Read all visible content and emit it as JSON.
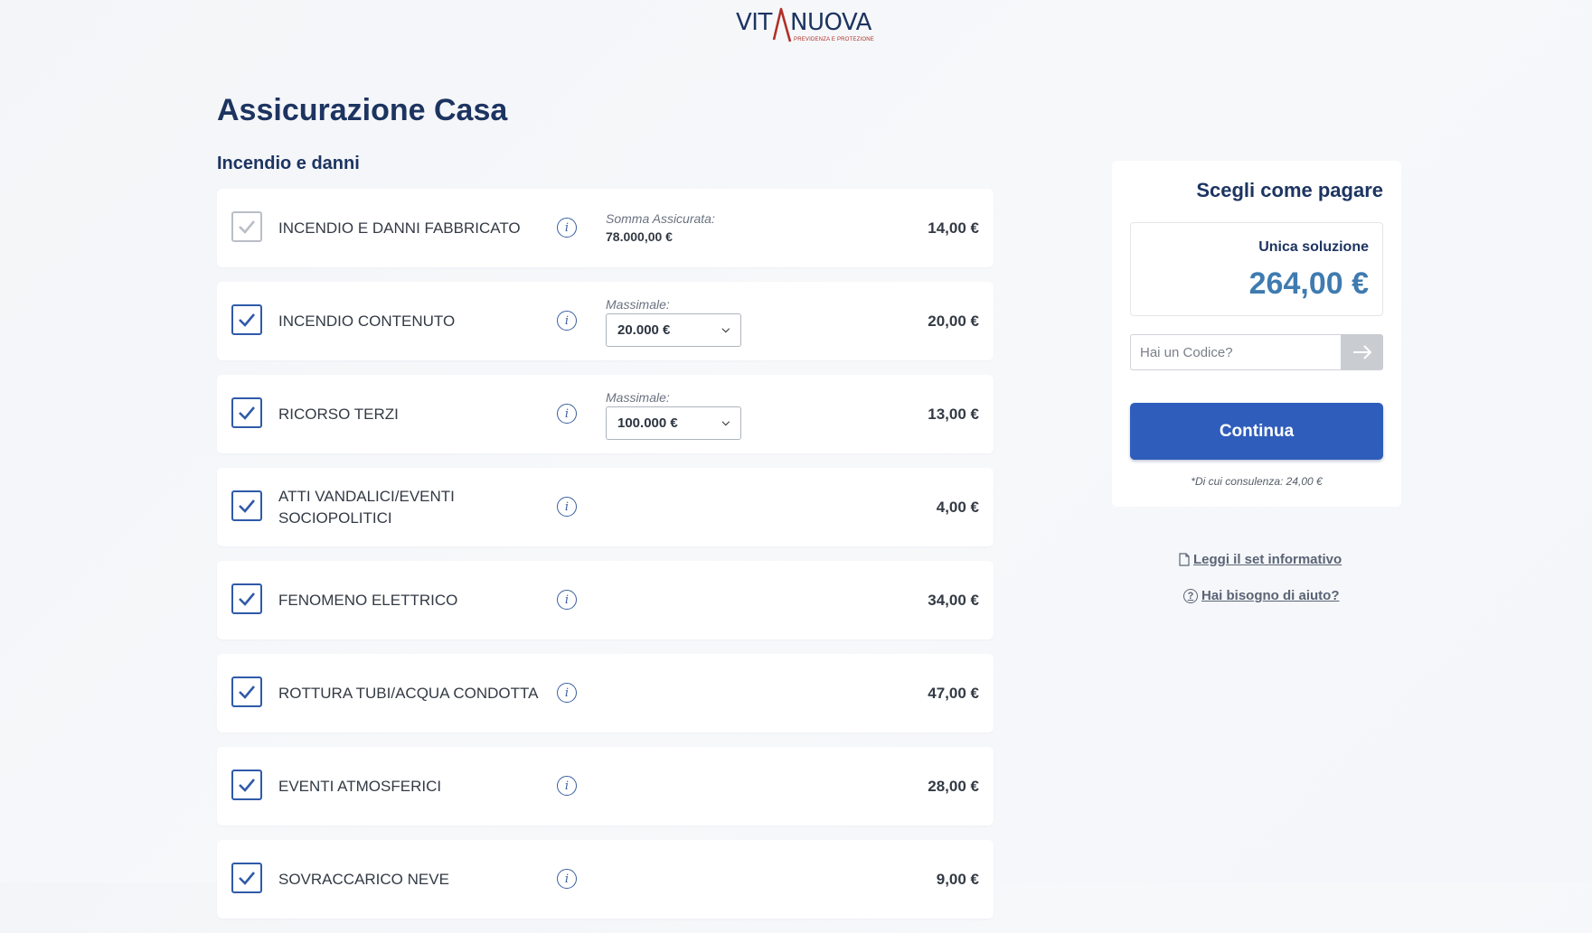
{
  "brand": {
    "name_left": "VIT",
    "name_right": "NUOVA",
    "tagline": "PREVIDENZA E PROTEZIONE"
  },
  "page": {
    "title": "Assicurazione Casa",
    "section_title": "Incendio e danni"
  },
  "coverages": [
    {
      "label": "INCENDIO E DANNI FABBRICATO",
      "checked": true,
      "disabled": true,
      "option_caption": "Somma Assicurata:",
      "option_value": "78.000,00 €",
      "price": "14,00 €"
    },
    {
      "label": "INCENDIO CONTENUTO",
      "checked": true,
      "option_caption": "Massimale:",
      "select_value": "20.000 €",
      "price": "20,00 €"
    },
    {
      "label": "RICORSO TERZI",
      "checked": true,
      "option_caption": "Massimale:",
      "select_value": "100.000 €",
      "price": "13,00 €"
    },
    {
      "label": "ATTI VANDALICI/EVENTI SOCIOPOLITICI",
      "checked": true,
      "price": "4,00 €"
    },
    {
      "label": "FENOMENO ELETTRICO",
      "checked": true,
      "price": "34,00 €"
    },
    {
      "label": "ROTTURA TUBI/ACQUA CONDOTTA",
      "checked": true,
      "price": "47,00 €"
    },
    {
      "label": "EVENTI ATMOSFERICI",
      "checked": true,
      "price": "28,00 €"
    },
    {
      "label": "SOVRACCARICO NEVE",
      "checked": true,
      "price": "9,00 €"
    }
  ],
  "payment": {
    "title": "Scegli come pagare",
    "option_label": "Unica soluzione",
    "amount": "264,00 €",
    "code_placeholder": "Hai un Codice?",
    "continue_label": "Continua",
    "consulenza_note": "*Di cui consulenza: 24,00 €"
  },
  "links": {
    "info_set": "Leggi il set informativo",
    "help": "Hai bisogno di aiuto?"
  },
  "colors": {
    "primary": "#2f5dbb",
    "navy": "#1d3461",
    "amount": "#3f7bb0",
    "logo_accent": "#b03028"
  }
}
